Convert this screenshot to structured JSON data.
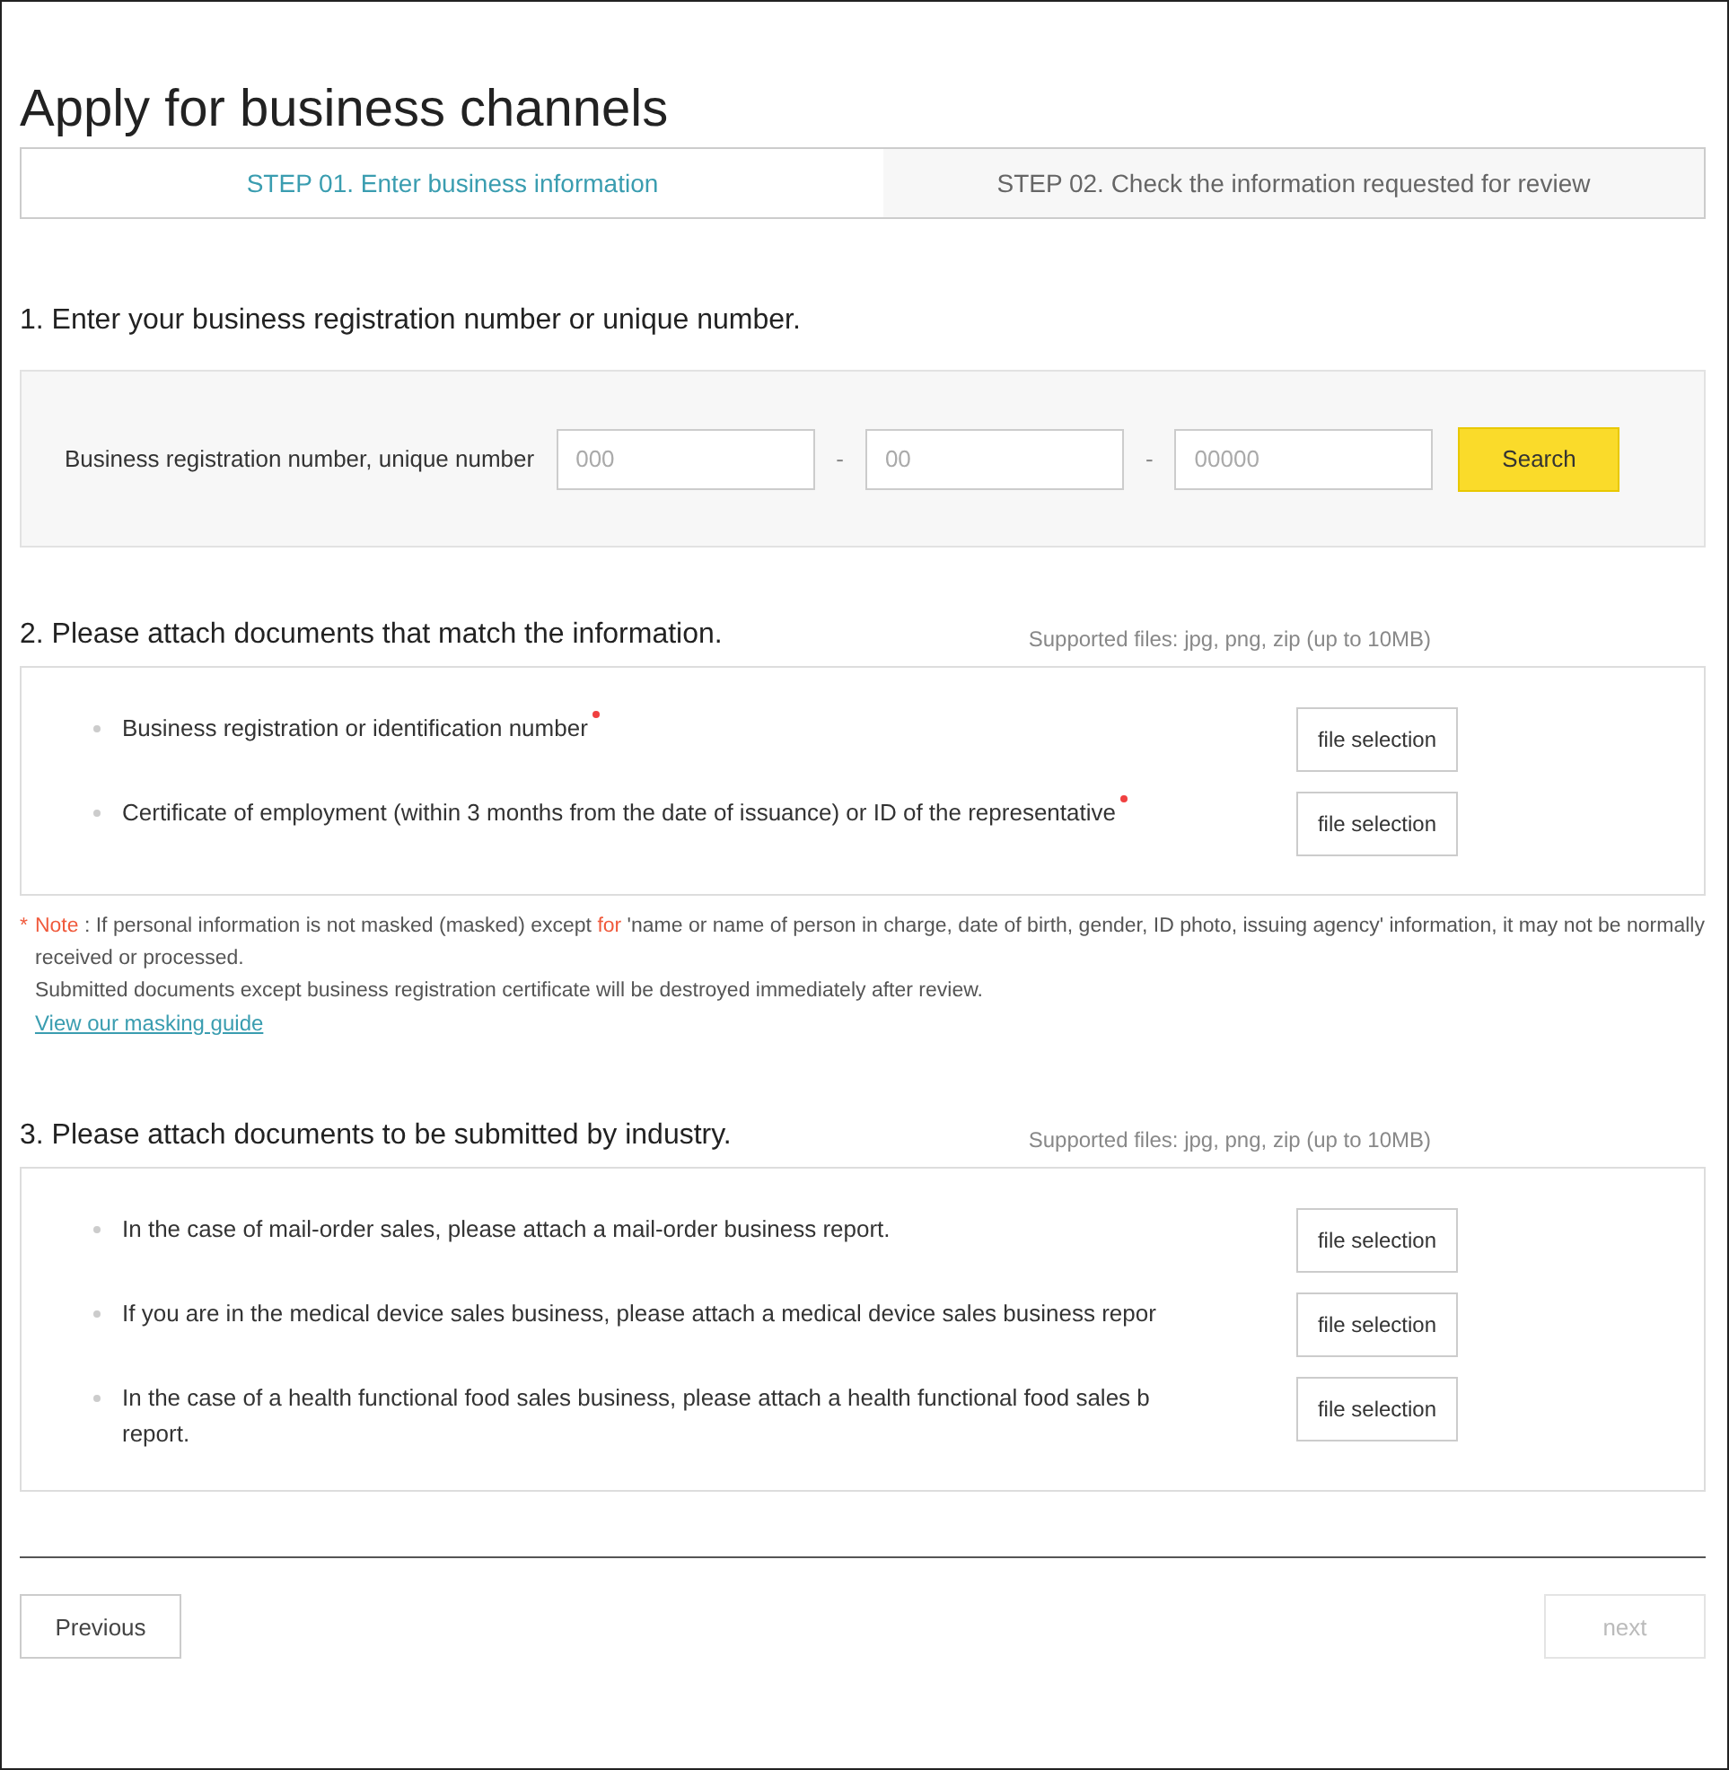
{
  "title": "Apply for business channels",
  "steps": [
    {
      "label": "STEP 01. Enter business information",
      "selected": true
    },
    {
      "label": "STEP 02. Check the information requested for review",
      "selected": false
    }
  ],
  "section1": {
    "heading": "1. Enter your business registration number or unique number.",
    "label": "Business registration number, unique number",
    "fields": [
      {
        "placeholder": "000"
      },
      {
        "placeholder": "00"
      },
      {
        "placeholder": "00000"
      }
    ],
    "separator": "-",
    "search_button": "Search"
  },
  "section2": {
    "heading": "2. Please attach documents that match the information.",
    "supported": "Supported files: jpg, png, zip (up to 10MB)",
    "items": [
      {
        "lines": [
          "Business registration or identification number"
        ],
        "required": true,
        "button": "file selection"
      },
      {
        "lines": [
          "Certificate of employment (within 3 months from the date of issuance) or ID of the representative"
        ],
        "required": true,
        "button": "file selection"
      }
    ],
    "note": {
      "marker": "*",
      "segments": [
        {
          "kind": "accent",
          "text": "Note"
        },
        {
          "kind": "plain",
          "text": " : If personal information is not masked (masked) except "
        },
        {
          "kind": "accent",
          "text": "for"
        },
        {
          "kind": "plain",
          "text": " 'name or name of person in charge, date of birth, gender, ID photo, issuing agency' information, it may not be normally received or processed."
        }
      ],
      "line2": "Submitted documents except business registration certificate will be destroyed immediately after review.",
      "link": "View our masking guide"
    }
  },
  "section3": {
    "heading": "3. Please attach documents to be submitted by industry.",
    "supported": "Supported files: jpg, png, zip (up to 10MB)",
    "items": [
      {
        "lines": [
          "In the case of mail-order sales, please attach a mail-order business report."
        ],
        "button": "file selection"
      },
      {
        "lines": [
          "If you are in the medical device sales business, please attach a medical device sales business repor"
        ],
        "button": "file selection"
      },
      {
        "lines": [
          "In the case of a health functional food sales business, please attach a health functional food sales b",
          "report."
        ],
        "button": "file selection"
      }
    ]
  },
  "footer": {
    "previous": {
      "label": "Previous",
      "disabled": false
    },
    "next": {
      "label": "next",
      "disabled": true
    }
  }
}
